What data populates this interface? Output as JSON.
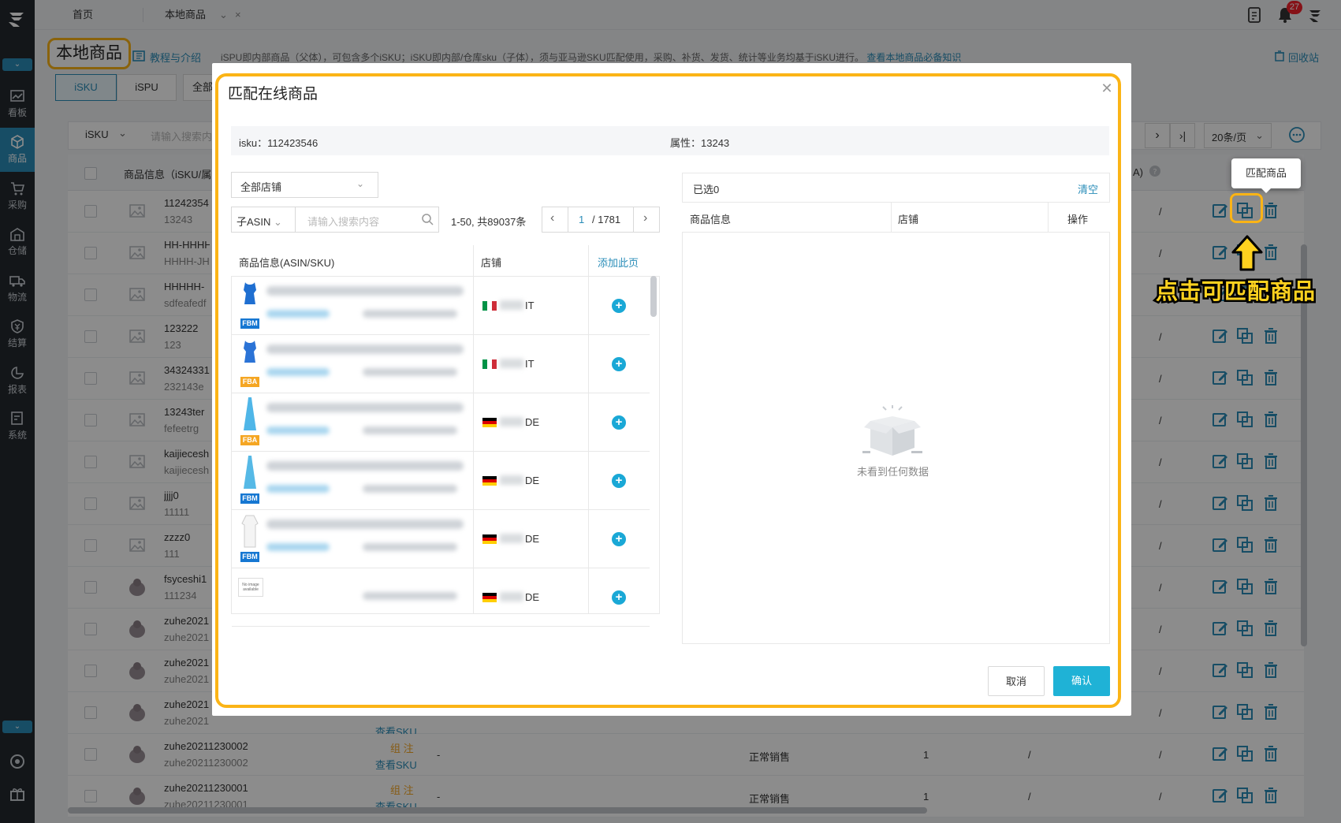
{
  "sidebar": {
    "items": [
      {
        "label": "看板",
        "icon": "chart-icon"
      },
      {
        "label": "商品",
        "icon": "box-icon"
      },
      {
        "label": "采购",
        "icon": "cart-icon"
      },
      {
        "label": "仓储",
        "icon": "warehouse-icon"
      },
      {
        "label": "物流",
        "icon": "truck-icon"
      },
      {
        "label": "结算",
        "icon": "coin-icon"
      },
      {
        "label": "报表",
        "icon": "pie-icon"
      },
      {
        "label": "系统",
        "icon": "system-icon"
      }
    ]
  },
  "topbar": {
    "home": "首页",
    "tab": "本地商品",
    "badge": "27"
  },
  "header": {
    "title": "本地商品",
    "tutorial": "教程与介绍",
    "description": "iSPU即内部商品（父体），可包含多个iSKU；iSKU即内部/仓库sku（子体），须与亚马逊SKU匹配使用，采购、补货、发货、统计等业务均基于iSKU进行。",
    "description_link": "查看本地商品必备知识",
    "recycle": "回收站",
    "subtabs": [
      "iSKU",
      "iSPU",
      "全部"
    ]
  },
  "filter": {
    "type": "iSKU",
    "placeholder": "请输入搜索内容",
    "page_size": "20条/页"
  },
  "bg_table": {
    "header_col": "商品信息（iSKU/属",
    "header_right": "A)",
    "rows": [
      {
        "name": "11242354",
        "sub": "13243"
      },
      {
        "name": "HH-HHHH",
        "sub": "HHHH-JH"
      },
      {
        "name": "HHHHH-",
        "sub": "sdfeafedf"
      },
      {
        "name": "123222",
        "sub": "123"
      },
      {
        "name": "34324331",
        "sub": "232143e"
      },
      {
        "name": "13243ter",
        "sub": "fefeetrg"
      },
      {
        "name": "kaijiecesh",
        "sub": "kaijiecesh"
      },
      {
        "name": "jjjj0",
        "sub": "11111"
      },
      {
        "name": "zzzz0",
        "sub": "111"
      },
      {
        "name": "fsyceshi1",
        "sub": "111234"
      },
      {
        "name": "zuhe2021",
        "sub": "zuhe2021"
      },
      {
        "name": "zuhe2021",
        "sub": "zuhe2021"
      },
      {
        "name": "zuhe2021",
        "sub": "zuhe2021"
      },
      {
        "name": "zuhe20211230002",
        "sub": "zuhe20211230002",
        "tag": "组 注",
        "link": "查看SKU",
        "dash": "-",
        "status": "正常销售",
        "qty": "1"
      },
      {
        "name": "zuhe20211230001",
        "sub": "zuhe20211230001",
        "tag": "组 注",
        "link": "查看SKU",
        "dash": "-",
        "status": "正常销售",
        "qty": "1"
      }
    ],
    "slash": "/",
    "partial_link": "查看SKU"
  },
  "tooltip": "匹配商品",
  "annotation": "点击可匹配商品",
  "modal": {
    "title": "匹配在线商品",
    "isku_label": "isku：112423546",
    "attr_label": "属性：13243",
    "store_select": "全部店铺",
    "search_type": "子ASIN",
    "search_placeholder": "请输入搜索内容",
    "count": "1-50, 共89037条",
    "page_current": "1",
    "page_total": "/ 1781",
    "col_info": "商品信息(ASIN/SKU)",
    "col_store": "店铺",
    "add_page": "添加此页",
    "rows": [
      {
        "tag": "FBM",
        "country": "IT",
        "flag": "italy-flag"
      },
      {
        "tag": "FBA",
        "country": "IT",
        "flag": "italy-flag"
      },
      {
        "tag": "FBA",
        "country": "DE",
        "flag": "germany-flag"
      },
      {
        "tag": "FBM",
        "country": "DE",
        "flag": "germany-flag"
      },
      {
        "tag": "FBM",
        "country": "DE",
        "flag": "germany-flag"
      },
      {
        "tag": "",
        "country": "DE",
        "flag": "germany-flag",
        "noimg": "No image available"
      }
    ],
    "selected": "已选0",
    "clear": "清空",
    "r_col_info": "商品信息",
    "r_col_store": "店铺",
    "r_col_action": "操作",
    "empty": "未看到任何数据",
    "cancel": "取消",
    "confirm": "确认"
  },
  "colors": {
    "accent": "#2a8db8",
    "highlight": "#fbb416",
    "fbm": "#1677d2",
    "fba": "#f5a623"
  }
}
